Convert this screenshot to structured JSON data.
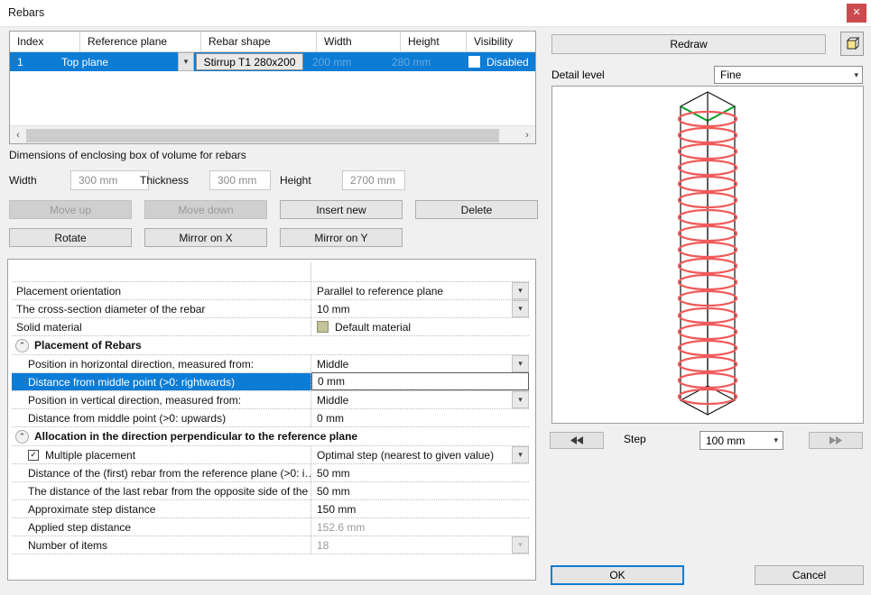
{
  "window": {
    "title": "Rebars",
    "close_label": "✕"
  },
  "rebar_table": {
    "columns": [
      "Index",
      "Reference plane",
      "Rebar shape",
      "Width",
      "Height",
      "Visibility"
    ],
    "rows": [
      {
        "index": "1",
        "reference_plane": "Top plane",
        "rebar_shape": "Stirrup T1 280x200",
        "width": "200 mm",
        "height": "280 mm",
        "visibility": "Disabled",
        "visibility_checked": false,
        "selected": true
      }
    ],
    "scroll_left_icon": "‹",
    "scroll_right_icon": "›"
  },
  "enclosing_box": {
    "caption": "Dimensions of enclosing box of volume for rebars",
    "width_label": "Width",
    "width_value": "300 mm",
    "thickness_label": "Thickness",
    "thickness_value": "300 mm",
    "height_label": "Height",
    "height_value": "2700 mm"
  },
  "actions": {
    "move_up": "Move up",
    "move_down": "Move down",
    "insert_new": "Insert new",
    "delete": "Delete",
    "rotate": "Rotate",
    "mirror_on_x": "Mirror on X",
    "mirror_on_y": "Mirror on Y"
  },
  "properties": {
    "placement_orientation": {
      "key": "Placement orientation",
      "value": "Parallel to reference plane"
    },
    "cross_section_diameter": {
      "key": "The cross-section diameter of the rebar",
      "value": "10 mm"
    },
    "solid_material": {
      "key": "Solid material",
      "value": "Default material",
      "swatch_color": "#c3c399"
    },
    "group_placement": {
      "title": "Placement of Rebars",
      "chevron": "⌃"
    },
    "horizontal_position": {
      "key": "Position in horizontal direction, measured from:",
      "value": "Middle"
    },
    "horizontal_distance": {
      "key": "Distance from middle point (>0: rightwards)",
      "value": "0 mm"
    },
    "vertical_position": {
      "key": "Position in vertical direction, measured from:",
      "value": "Middle"
    },
    "vertical_distance": {
      "key": "Distance from middle point (>0: upwards)",
      "value": "0 mm"
    },
    "group_allocation": {
      "title": "Allocation in the direction perpendicular to the reference plane",
      "chevron": "⌃"
    },
    "multiple_placement": {
      "key": "Multiple placement",
      "value": "Optimal step (nearest to given value)",
      "checked": true
    },
    "first_rebar_distance": {
      "key": "Distance of the (first) rebar from the reference plane (>0: i…",
      "value": "50 mm"
    },
    "last_rebar_distance": {
      "key": "The distance of the last rebar from the opposite side of the …",
      "value": "50 mm"
    },
    "approximate_step": {
      "key": "Approximate step distance",
      "value": "150 mm"
    },
    "applied_step": {
      "key": "Applied step distance",
      "value": "152.6 mm"
    },
    "number_of_items": {
      "key": "Number of items",
      "value": "18"
    }
  },
  "preview": {
    "redraw_label": "Redraw",
    "detail_level_label": "Detail level",
    "detail_level_value": "Fine",
    "step_label": "Step",
    "step_value": "100 mm",
    "step_prev_icon": "◀▐",
    "step_next_icon": "▌▶",
    "dropdown_arrow": "⌵",
    "rebar_count": 18,
    "rebar_color": "#f05a5a",
    "box_color": "#1a1a1a",
    "top_edge_color": "#0aa02a"
  },
  "footer": {
    "ok_label": "OK",
    "cancel_label": "Cancel"
  }
}
